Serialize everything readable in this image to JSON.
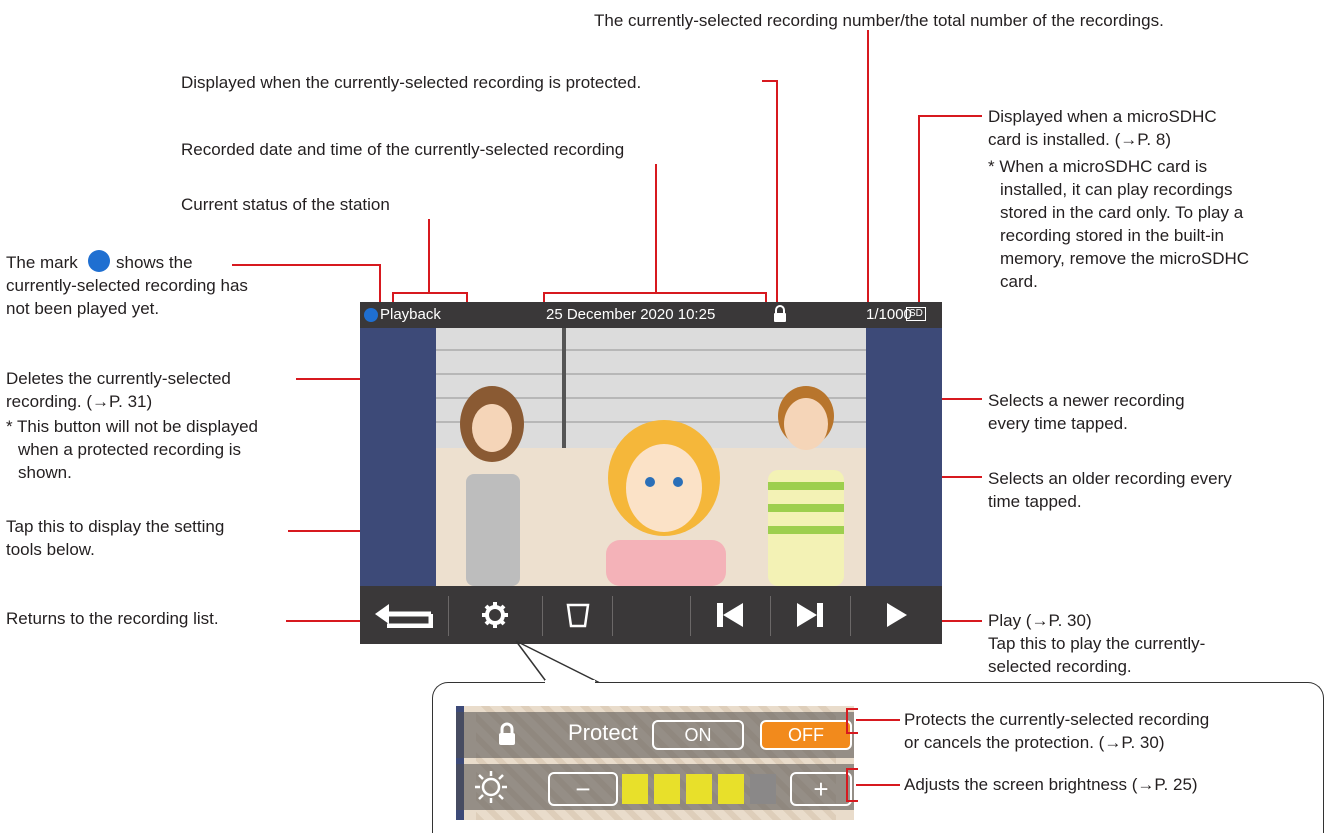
{
  "annotations": {
    "recording_number": "The currently-selected recording number/the total number of the recordings.",
    "protected": "Displayed when the currently-selected recording is protected.",
    "sd_1": "Displayed when a microSDHC",
    "sd_2": "card is installed. (→P. 8)",
    "sd_note_1": "* When a microSDHC card is",
    "sd_note_2": "installed, it can play recordings",
    "sd_note_3": "stored in the card only. To play a",
    "sd_note_4": "recording stored in the built-in",
    "sd_note_5": "memory, remove the microSDHC",
    "sd_note_6": "card.",
    "datetime": "Recorded date and time of the currently-selected recording",
    "status": "Current status of the station",
    "mark_1a": "The mark",
    "mark_1b": "shows the",
    "mark_2": "currently-selected recording has",
    "mark_3": "not been played yet.",
    "delete_1": "Deletes the currently-selected",
    "delete_2": "recording. (→P. 31)",
    "delete_note_1": "* This button will not be displayed",
    "delete_note_2": "when a protected recording is",
    "delete_note_3": "shown.",
    "settings_1": "Tap this to display the setting",
    "settings_2": "tools below.",
    "return": "Returns to the recording list.",
    "newer_1": "Selects a newer recording",
    "newer_2": "every time tapped.",
    "older_1": "Selects an older recording every",
    "older_2": "time tapped.",
    "play_1": "Play (→P. 30)",
    "play_2": "Tap this to play the currently-",
    "play_3": "selected recording.",
    "protect_1": "Protects the currently-selected recording",
    "protect_2": "or cancels the protection. (→P. 30)",
    "brightness": "Adjusts the screen brightness (→P. 25)"
  },
  "screen": {
    "status": "Playback",
    "datetime": "25 December 2020 10:25",
    "counter": "1/1000",
    "sd_badge": "SD"
  },
  "panel": {
    "protect_label": "Protect",
    "on_label": "ON",
    "off_label": "OFF",
    "minus": "−",
    "plus": "+",
    "brightness_level": 4,
    "brightness_max": 5
  },
  "icons": [
    "unplayed-mark-icon",
    "lock-icon",
    "sd-card-icon",
    "back-arrow-icon",
    "gear-icon",
    "trash-icon",
    "skip-previous-icon",
    "skip-next-icon",
    "play-icon",
    "sun-icon"
  ],
  "colors": {
    "leader": "#d7191f",
    "unplayed": "#1f6fd1",
    "off_button": "#f28a1c",
    "brightness_on": "#e8e02a"
  }
}
